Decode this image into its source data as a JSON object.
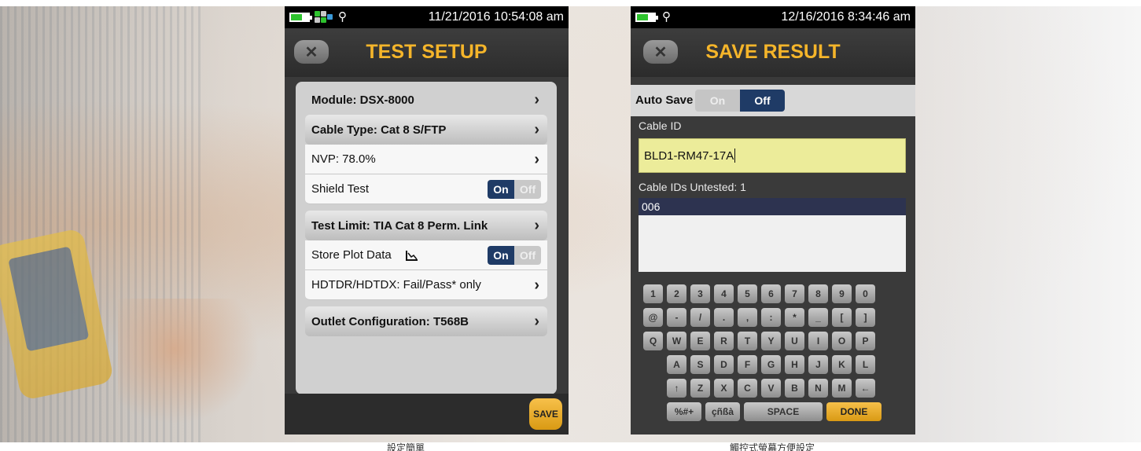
{
  "captions": {
    "left": "設定簡單",
    "right": "觸控式螢幕方便設定"
  },
  "test_setup": {
    "status_time": "11/21/2016 10:54:08 am",
    "title": "TEST SETUP",
    "rows": {
      "module": "Module: DSX-8000",
      "cable_type": "Cable Type: Cat 8 S/FTP",
      "nvp": "NVP: 78.0%",
      "shield_test": "Shield Test",
      "test_limit": "Test Limit: TIA Cat 8 Perm. Link",
      "store_plot": "Store Plot Data",
      "hdtdr": "HDTDR/HDTDX: Fail/Pass* only",
      "outlet": "Outlet Configuration: T568B"
    },
    "toggle_on": "On",
    "toggle_off": "Off",
    "save_label": "SAVE"
  },
  "save_result": {
    "status_time": "12/16/2016 8:34:46 am",
    "title": "SAVE RESULT",
    "auto_save_label": "Auto Save",
    "auto_save_on": "On",
    "auto_save_off": "Off",
    "cable_id_label": "Cable ID",
    "cable_id_value": "BLD1-RM47-17A",
    "untested_label": "Cable IDs Untested: 1",
    "untested_items": [
      "006"
    ],
    "keyboard": {
      "row1": [
        "1",
        "2",
        "3",
        "4",
        "5",
        "6",
        "7",
        "8",
        "9",
        "0"
      ],
      "row2": [
        "@",
        "-",
        "/",
        ".",
        ",",
        ":",
        "*",
        "_",
        "[",
        "]"
      ],
      "row3": [
        "Q",
        "W",
        "E",
        "R",
        "T",
        "Y",
        "U",
        "I",
        "O",
        "P"
      ],
      "row4": [
        "A",
        "S",
        "D",
        "F",
        "G",
        "H",
        "J",
        "K",
        "L"
      ],
      "row5": [
        "↑",
        "Z",
        "X",
        "C",
        "V",
        "B",
        "N",
        "M",
        "←"
      ],
      "symbols": "%#+",
      "accents": "çñßà",
      "space": "SPACE",
      "done": "DONE"
    }
  },
  "icons": {
    "back": "close-x-icon",
    "battery": "battery-icon",
    "connection": "connection-status-icon",
    "pin": "location-pin-icon",
    "chevron": "chevron-right-icon",
    "plot": "plot-graph-icon"
  },
  "colors": {
    "title_accent": "#f5b52a",
    "toggle_active": "#1f3b66",
    "input_bg": "#ecec9a",
    "button_accent": "#f7c04a"
  }
}
